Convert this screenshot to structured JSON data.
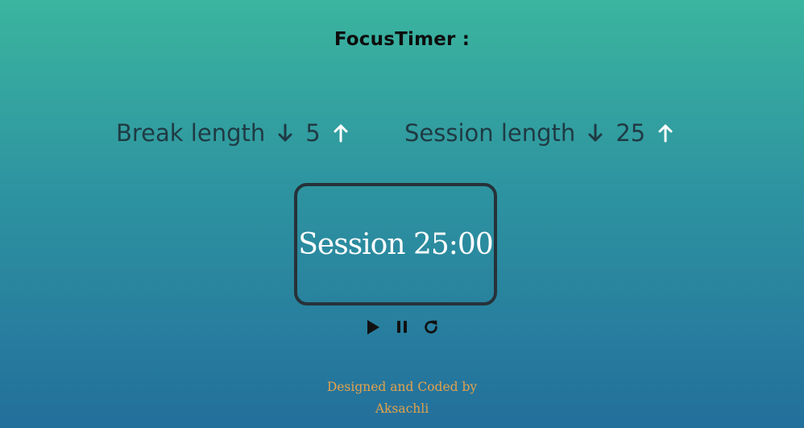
{
  "app": {
    "title": "FocusTimer :"
  },
  "break": {
    "label": "Break length",
    "value": "5",
    "decrement_icon": "arrow-down-icon",
    "increment_icon": "arrow-up-icon"
  },
  "session": {
    "label": "Session length",
    "value": "25",
    "decrement_icon": "arrow-down-icon",
    "increment_icon": "arrow-up-icon"
  },
  "timer": {
    "display": "Session 25:00"
  },
  "controls": {
    "play_icon": "play-icon",
    "pause_icon": "pause-icon",
    "reset_icon": "refresh-icon"
  },
  "footer": {
    "line1": "Designed and Coded by",
    "line2": "Aksachli"
  },
  "colors": {
    "gradient_top": "#3bb59f",
    "gradient_bottom": "#236f9c",
    "footer_text": "#e3a24b",
    "timer_border": "#263238"
  }
}
